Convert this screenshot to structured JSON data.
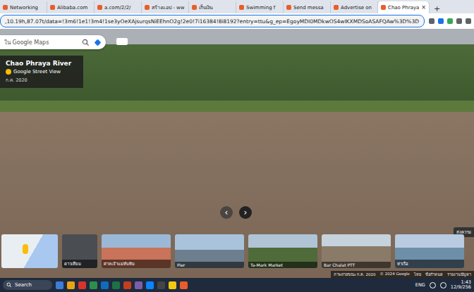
{
  "browser": {
    "tabs": [
      {
        "label": "Networking",
        "selected": false
      },
      {
        "label": "Alibaba.com",
        "selected": false
      },
      {
        "label": "a.com/2/2/",
        "selected": false
      },
      {
        "label": "สร้างแอป - ww",
        "selected": false
      },
      {
        "label": "เก็บเงิน",
        "selected": false
      },
      {
        "label": "Swimming f",
        "selected": false
      },
      {
        "label": "Send messa",
        "selected": false
      },
      {
        "label": "Advertise on",
        "selected": false
      },
      {
        "label": "Chao Phraya",
        "selected": true
      }
    ],
    "new_tab": "+",
    "close": "×",
    "url": ",10.19h,87.07t/data=!3m6!1e1!3m4!1se3yOeXAjsurqsNiEEhnO2g!2e0!7i16384!8i8192?entry=ttu&g_ep=EgoyMDI0MDkwOS4wIKXMDSoASAFQAw%3D%3D"
  },
  "maps": {
    "search_placeholder": "ใน Google Maps",
    "place_card": {
      "title": "Chao Phraya River",
      "subtitle": "Google Street View",
      "date": "ก.ค. 2020"
    },
    "nav": {
      "prev": "‹",
      "next": "›"
    },
    "filmstrip": [
      {
        "kind": "map",
        "label": ""
      },
      {
        "kind": "satellite",
        "label": "ดาวเทียม"
      },
      {
        "kind": "photo",
        "label": "ศาลเจ้าแม่ทับทิม"
      },
      {
        "kind": "photo",
        "label": "Pier"
      },
      {
        "kind": "photo",
        "label": "Ta-Mark Market"
      },
      {
        "kind": "photo",
        "label": "Bar Chalat PTT"
      },
      {
        "kind": "photo",
        "label": "ท่าเรือ"
      }
    ],
    "footer": [
      "ภาพถ่ายขณะ ก.ค. 2020",
      "© 2024 Google",
      "ไทย",
      "ข้อกำหนด",
      "รายงานปัญหา"
    ],
    "feedback": "ส่งความ"
  },
  "taskbar": {
    "search": "Search",
    "lang": "ENG",
    "time": "1:43",
    "date": "12/9/256"
  }
}
